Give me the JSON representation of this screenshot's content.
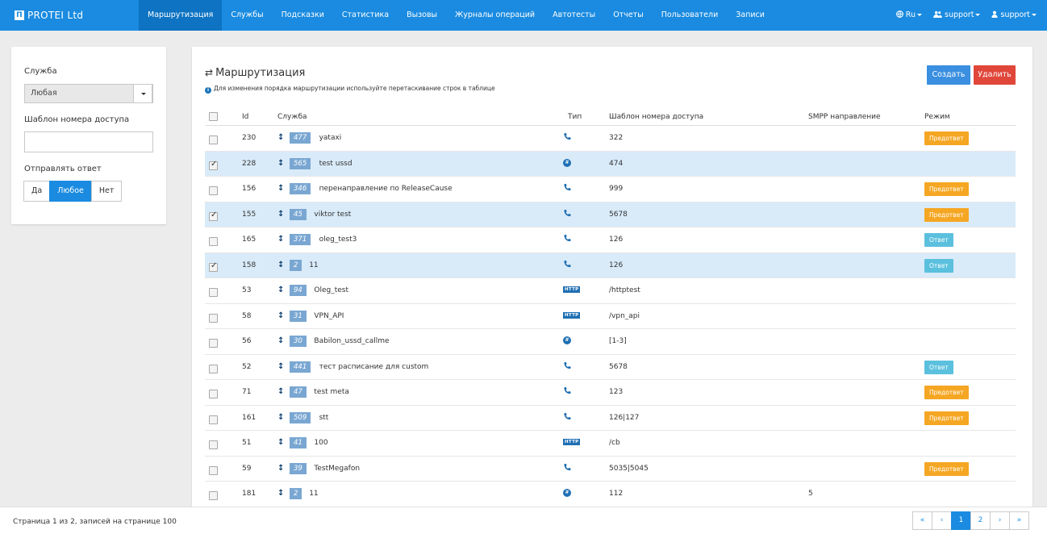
{
  "brand": {
    "logo": "Π",
    "name": "PROTEI Ltd"
  },
  "nav": {
    "items": [
      {
        "label": "Маршрутизация",
        "active": true
      },
      {
        "label": "Службы"
      },
      {
        "label": "Подсказки"
      },
      {
        "label": "Статистика"
      },
      {
        "label": "Вызовы"
      },
      {
        "label": "Журналы операций"
      },
      {
        "label": "Автотесты"
      },
      {
        "label": "Отчеты"
      },
      {
        "label": "Пользователи"
      },
      {
        "label": "Записи"
      }
    ],
    "right": [
      {
        "label": "Ru",
        "icon": "globe-icon"
      },
      {
        "label": "support",
        "icon": "users-icon"
      },
      {
        "label": "support",
        "icon": "user-icon"
      }
    ]
  },
  "filters": {
    "service_label": "Служба",
    "service_value": "Любая",
    "template_label": "Шаблон номера доступа",
    "template_value": "",
    "reply_label": "Отправлять ответ",
    "reply_options": [
      "Да",
      "Любое",
      "Нет"
    ],
    "reply_selected": "Любое"
  },
  "main": {
    "title": "Маршрутизация",
    "hint": "Для изменения порядка маршрутизации используйте перетаскивание строк в таблице",
    "create_label": "Создать",
    "delete_label": "Удалить",
    "columns": {
      "id": "Id",
      "service": "Служба",
      "type": "Тип",
      "template": "Шаблон номера доступа",
      "smpp": "SMPP направление",
      "mode": "Режим"
    },
    "rows": [
      {
        "id": "230",
        "badge": "477",
        "service": "yataxi",
        "type": "phone",
        "template": "322",
        "smpp": "",
        "mode": "Предответ",
        "selected": false
      },
      {
        "id": "228",
        "badge": "565",
        "service": "test ussd",
        "type": "ussd",
        "template": "474",
        "smpp": "",
        "mode": "",
        "selected": true
      },
      {
        "id": "156",
        "badge": "346",
        "service": "перенаправление по ReleaseCause",
        "type": "phone",
        "template": "999",
        "smpp": "",
        "mode": "Предответ",
        "selected": false
      },
      {
        "id": "155",
        "badge": "45",
        "service": "viktor test",
        "type": "phone",
        "template": "5678",
        "smpp": "",
        "mode": "Предответ",
        "selected": true
      },
      {
        "id": "165",
        "badge": "371",
        "service": "oleg_test3",
        "type": "phone",
        "template": "126",
        "smpp": "",
        "mode": "Ответ",
        "selected": false
      },
      {
        "id": "158",
        "badge": "2",
        "service": "11",
        "type": "phone",
        "template": "126",
        "smpp": "",
        "mode": "Ответ",
        "selected": true
      },
      {
        "id": "53",
        "badge": "94",
        "service": "Oleg_test",
        "type": "http",
        "template": "/httptest",
        "smpp": "",
        "mode": "",
        "selected": false
      },
      {
        "id": "58",
        "badge": "31",
        "service": "VPN_API",
        "type": "http",
        "template": "/vpn_api",
        "smpp": "",
        "mode": "",
        "selected": false
      },
      {
        "id": "56",
        "badge": "30",
        "service": "Babilon_ussd_callme",
        "type": "ussd",
        "template": "[1-3]",
        "smpp": "",
        "mode": "",
        "selected": false
      },
      {
        "id": "52",
        "badge": "441",
        "service": "тест расписание для custom",
        "type": "phone",
        "template": "5678",
        "smpp": "",
        "mode": "Ответ",
        "selected": false
      },
      {
        "id": "71",
        "badge": "47",
        "service": "test meta",
        "type": "phone",
        "template": "123",
        "smpp": "",
        "mode": "Предответ",
        "selected": false
      },
      {
        "id": "161",
        "badge": "509",
        "service": "stt",
        "type": "phone",
        "template": "126|127",
        "smpp": "",
        "mode": "Предответ",
        "selected": false
      },
      {
        "id": "51",
        "badge": "41",
        "service": "100",
        "type": "http",
        "template": "/cb",
        "smpp": "",
        "mode": "",
        "selected": false
      },
      {
        "id": "59",
        "badge": "39",
        "service": "TestMegafon",
        "type": "phone",
        "template": "5035|5045",
        "smpp": "",
        "mode": "Предответ",
        "selected": false
      },
      {
        "id": "181",
        "badge": "2",
        "service": "11",
        "type": "ussd",
        "template": "112",
        "smpp": "5",
        "mode": "",
        "selected": false
      }
    ]
  },
  "footer": {
    "status": "Страница 1 из 2, записей на странице 100",
    "pages": [
      "«",
      "‹",
      "1",
      "2",
      "›",
      "»"
    ],
    "current_page": "1"
  },
  "colors": {
    "primary": "#1a8be0",
    "danger": "#e0463a",
    "pre_answer": "#f5a623",
    "answer": "#5bc0de",
    "badge": "#7aa7d2",
    "selected_row": "#d9ebf9"
  }
}
